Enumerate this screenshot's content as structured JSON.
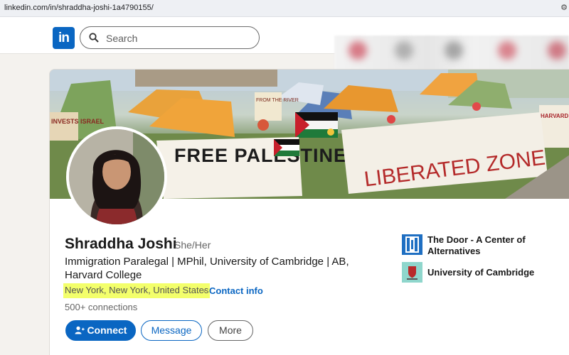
{
  "browser": {
    "url": "linkedin.com/in/shraddha-joshi-1a4790155/"
  },
  "nav": {
    "logo_text": "in",
    "search_placeholder": "Search"
  },
  "banner": {
    "sign_left": "FREE PALESTINE",
    "sign_right": "LIBERATED ZONE",
    "sign_small_left": "INVESTS ISRAEL",
    "sign_small_mid": "FROM THE RIVER",
    "sign_far_right": "HARVARD OUT"
  },
  "profile": {
    "name": "Shraddha Joshi",
    "pronouns": "She/Her",
    "headline": "Immigration Paralegal | MPhil, University of Cambridge | AB, Harvard College",
    "location": "New York, New York, United States",
    "separator": "·",
    "contact_info": "Contact info",
    "connections": "500+ connections"
  },
  "actions": {
    "connect": "Connect",
    "message": "Message",
    "more": "More"
  },
  "organizations": [
    {
      "name": "The Door - A Center of Alternatives",
      "logo_color": "#1f6fc2"
    },
    {
      "name": "University of Cambridge",
      "logo_color": "#8fd6cc"
    }
  ],
  "colors": {
    "brand": "#0a66c2",
    "highlight": "#f3ff6b"
  }
}
